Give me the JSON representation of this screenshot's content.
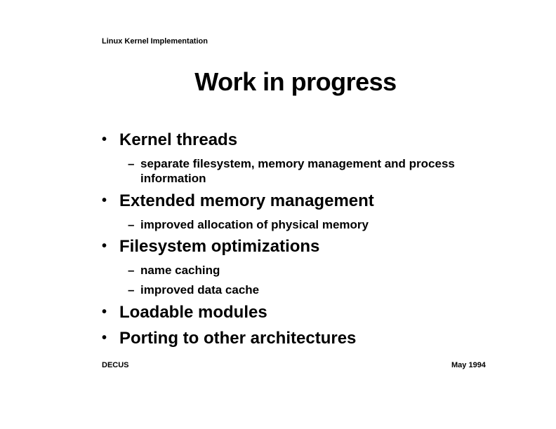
{
  "header": {
    "text": "Linux Kernel Implementation"
  },
  "title": "Work in progress",
  "bullets": [
    {
      "label": "Kernel threads",
      "subs": [
        "separate filesystem, memory management and process information"
      ]
    },
    {
      "label": "Extended memory management",
      "subs": [
        "improved allocation of physical memory"
      ]
    },
    {
      "label": "Filesystem optimizations",
      "subs": [
        "name caching",
        "improved data cache"
      ]
    },
    {
      "label": "Loadable modules",
      "subs": []
    },
    {
      "label": "Porting to other architectures",
      "subs": []
    }
  ],
  "glyphs": {
    "bullet": "•",
    "dash": "–"
  },
  "footer": {
    "left": "DECUS",
    "right": "May 1994"
  }
}
